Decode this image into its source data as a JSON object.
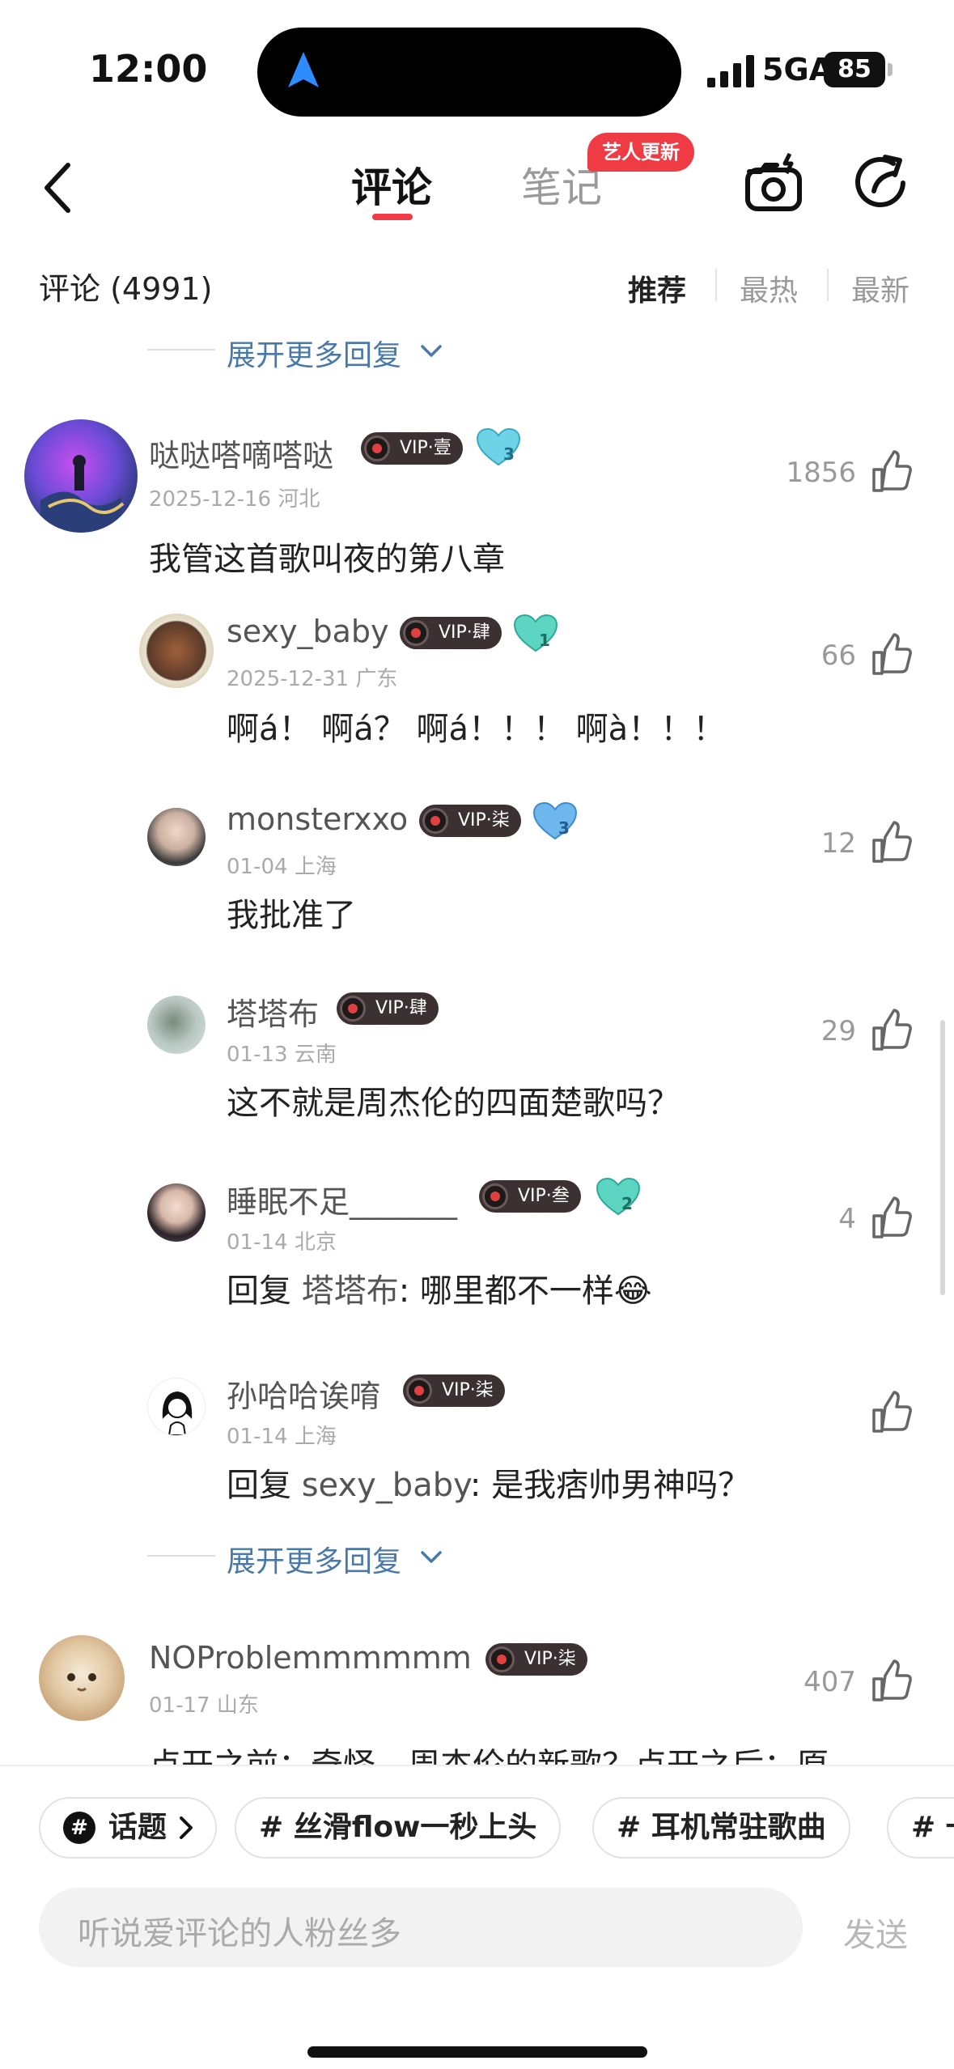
{
  "status_bar": {
    "time": "12:00",
    "network": "5GA",
    "battery": "85"
  },
  "nav": {
    "tab_comments": "评论",
    "tab_notes": "笔记",
    "notes_badge": "艺人更新"
  },
  "comments_header": {
    "count_label": "评论 (4991)",
    "sort_options": [
      "推荐",
      "最热",
      "最新"
    ],
    "active_sort": "推荐"
  },
  "expand_more_label": "展开更多回复",
  "comments": [
    {
      "username": "哒哒嗒嘀嗒哒",
      "vip": "VIP·壹",
      "heart_level": "3",
      "date": "2025-12-16 河北",
      "likes": "1856",
      "text": "我管这首歌叫夜的第八章"
    },
    {
      "username": "sexy_baby",
      "vip": "VIP·肆",
      "heart_level": "1",
      "date": "2025-12-31 广东",
      "likes": "66",
      "text": "啊á！ 啊á？ 啊á！！！ 啊à！！！"
    },
    {
      "username": "monsterxxo",
      "vip": "VIP·柒",
      "heart_level": "3",
      "date": "01-04 上海",
      "likes": "12",
      "text": "我批准了"
    },
    {
      "username": "塔塔布",
      "vip": "VIP·肆",
      "heart_level": "",
      "date": "01-13 云南",
      "likes": "29",
      "text": "这不就是周杰伦的四面楚歌吗？"
    },
    {
      "username": "睡眠不足_______",
      "vip": "VIP·叁",
      "heart_level": "2",
      "date": "01-14 北京",
      "likes": "4",
      "reply_prefix": "回复 ",
      "reply_to": "塔塔布",
      "text": ": 哪里都不一样",
      "emoji": "😂"
    },
    {
      "username": "孙哈哈诶唷",
      "vip": "VIP·柒",
      "heart_level": "",
      "date": "01-14 上海",
      "likes": "",
      "reply_prefix": "回复 ",
      "reply_to": "sexy_baby",
      "text": ": 是我痞帅男神吗？"
    },
    {
      "username": "NOProblemmmmmm",
      "vip": "VIP·柒",
      "heart_level": "",
      "date": "01-17 山东",
      "likes": "407",
      "text": "点开之前：奇怪，周杰伦的新歌？点开之后：原"
    }
  ],
  "bottom_bar": {
    "topic_chip": "话题",
    "hashtags": [
      "# 丝滑flow一秒上头",
      "# 耳机常驻歌曲",
      "# 一"
    ],
    "input_placeholder": "听说爱评论的人粉丝多",
    "send_label": "发送"
  }
}
